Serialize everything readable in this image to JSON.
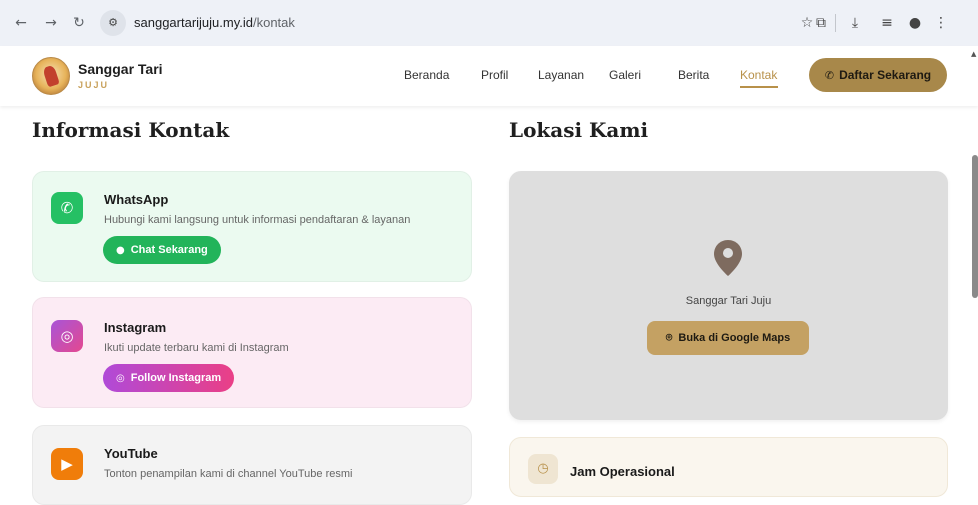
{
  "browser": {
    "url_host": "sanggartarijuju.my.id",
    "url_path": "/kontak",
    "icons": [
      "back-icon",
      "forward-icon",
      "reload-icon",
      "site-info-icon",
      "star-icon",
      "extensions-icon",
      "download-icon",
      "media-icon",
      "profile-icon",
      "menu-icon"
    ]
  },
  "header": {
    "brand_name": "Sanggar Tari",
    "brand_sub": "JUJU",
    "nav": [
      "Beranda",
      "Profil",
      "Layanan",
      "Galeri",
      "Berita",
      "Kontak"
    ],
    "active_nav": "Kontak",
    "cta_label": "Daftar Sekarang",
    "accent": "#b8914a"
  },
  "contact": {
    "title": "Informasi Kontak",
    "cards": [
      {
        "title": "WhatsApp",
        "desc": "Hubungi kami langsung untuk informasi pendaftaran & layanan",
        "button": "Chat Sekarang",
        "icon": "whatsapp-icon",
        "color": "#25c064"
      },
      {
        "title": "Instagram",
        "desc": "Ikuti update terbaru kami di Instagram",
        "button": "Follow Instagram",
        "icon": "instagram-icon",
        "color": "#c94fc2"
      },
      {
        "title": "YouTube",
        "desc": "Tonton penampilan kami di channel YouTube resmi",
        "icon": "youtube-icon",
        "color": "#f07d0a"
      }
    ]
  },
  "location": {
    "title": "Lokasi Kami",
    "place": "Sanggar Tari Juju",
    "map_button": "Buka di Google Maps",
    "hours_title": "Jam Operasional"
  }
}
